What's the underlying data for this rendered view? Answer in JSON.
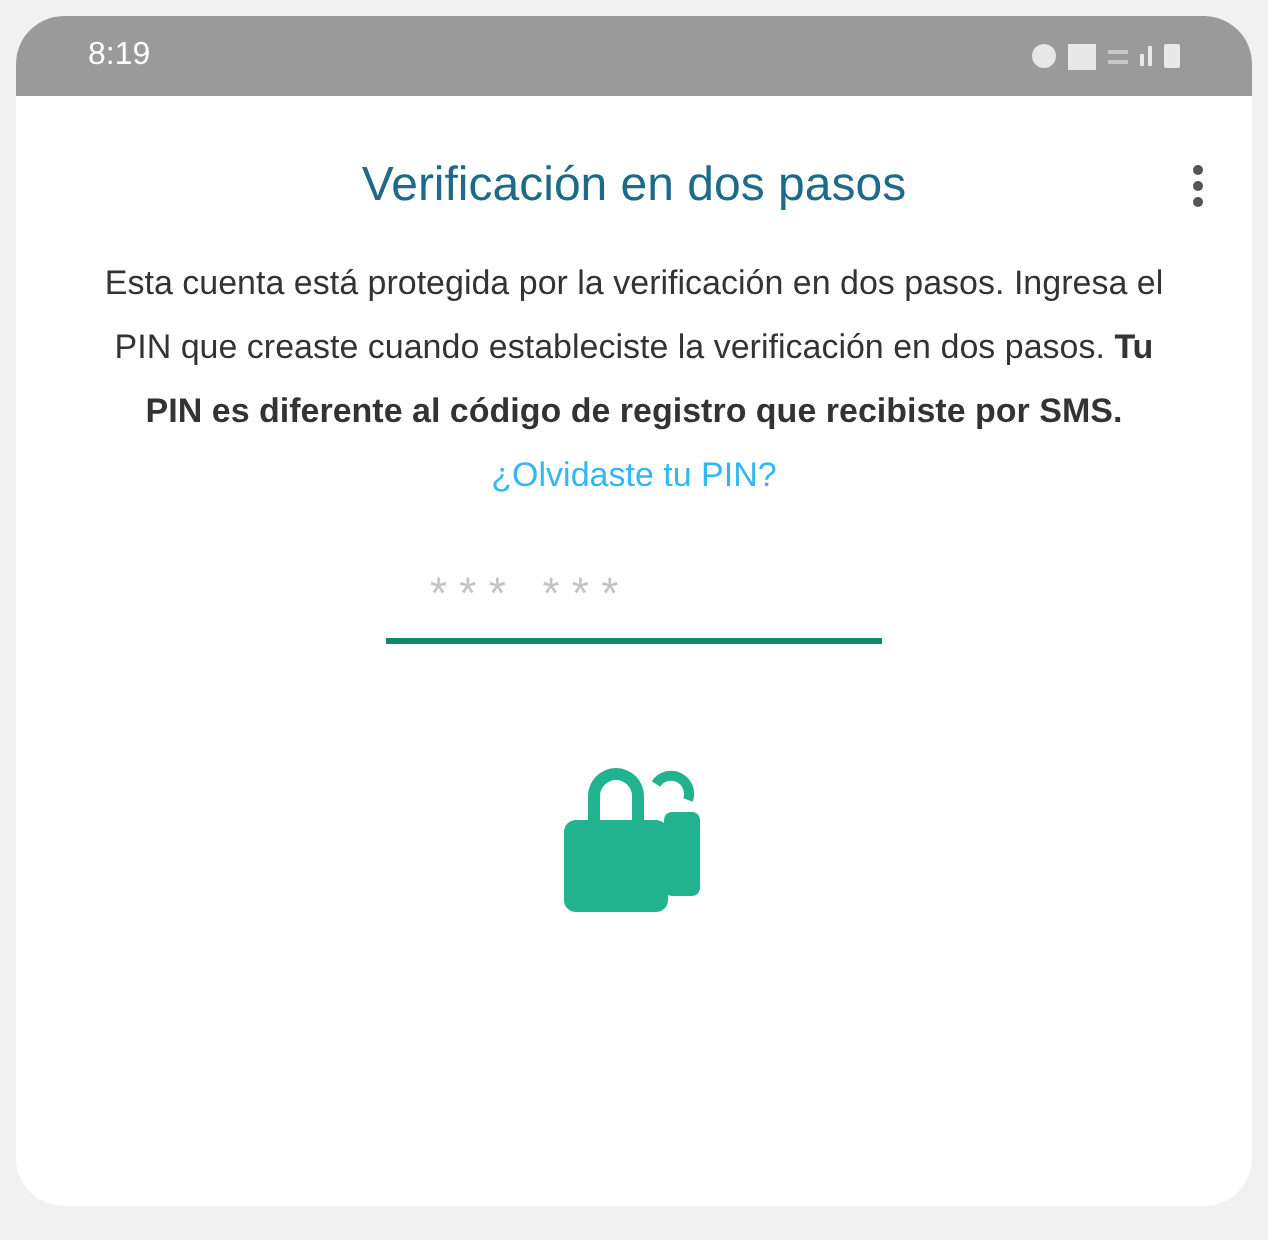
{
  "status_bar": {
    "time": "8:19"
  },
  "header": {
    "title": "Verificación en dos pasos"
  },
  "description": "Esta cuenta está protegida por la verificación en dos pasos. Ingresa el PIN que creaste cuando estableciste la verificación en dos pasos. **Tu PIN es diferente al código de registro que recibiste por SMS.**",
  "forgot_link": "¿Olvidaste tu PIN?",
  "pin_field": {
    "placeholder": "* * *   * * *"
  }
}
